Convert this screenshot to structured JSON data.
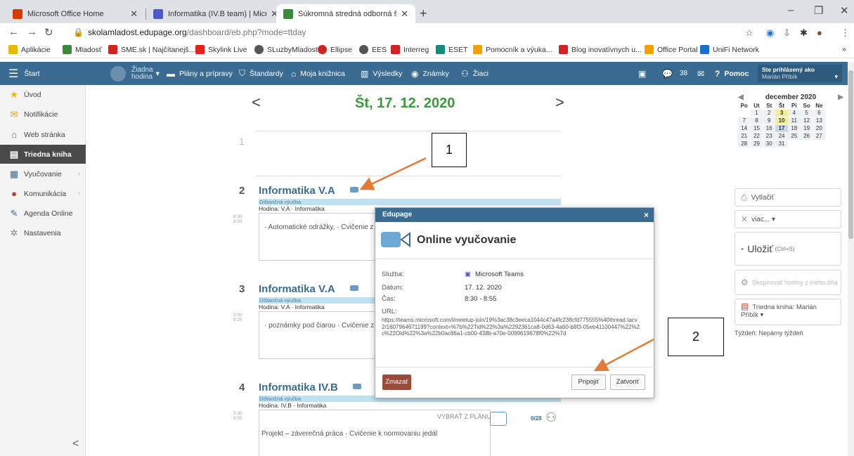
{
  "browser": {
    "tabs": [
      {
        "title": "Microsoft Office Home",
        "color": "#d83b01"
      },
      {
        "title": "Informatika (IV.B team) | Microso",
        "color": "#5059c9"
      },
      {
        "title": "Súkromná stredná odborná škola",
        "color": "#3a8a3a"
      }
    ],
    "new_tab": "+",
    "url_host": "skolamladost.edupage.org",
    "url_path": "/dashboard/eb.php?mode=ttday",
    "bookmarks": [
      {
        "label": "Aplikácie",
        "color": "#e6b800"
      },
      {
        "label": "Mladosť",
        "color": "#3a8a3a"
      },
      {
        "label": "SME.sk | Najčítanejš...",
        "color": "#d02424"
      },
      {
        "label": "Skylink Live",
        "color": "#e2231a"
      },
      {
        "label": "SLuzbyMladost",
        "color": "#555555"
      },
      {
        "label": "Ellipse",
        "color": "#d02424"
      },
      {
        "label": "EES",
        "color": "#555555"
      },
      {
        "label": "Interreg",
        "color": "#d02424"
      },
      {
        "label": "ESET",
        "color": "#1a8a7a"
      },
      {
        "label": "Pomocník a výuka...",
        "color": "#f2a100"
      },
      {
        "label": "Blog inovatívnych u...",
        "color": "#d02424"
      },
      {
        "label": "Office Portal",
        "color": "#f2a100"
      },
      {
        "label": "UniFi Network",
        "color": "#1a6fc9"
      }
    ],
    "bookmarks_more": "»"
  },
  "header": {
    "start": "Štart",
    "hodina_line1": "Žiadna",
    "hodina_line2": "hodina",
    "menu": [
      "Plány a prípravy",
      "Štandardy",
      "Moja knižnica",
      "Výsledky",
      "Známky",
      "Žiaci"
    ],
    "messages_count": "38",
    "help": "Pomoc",
    "logged_as_label": "Ste prihlásený ako",
    "logged_user": "Marián Příbík"
  },
  "sidebar": {
    "items": [
      {
        "label": "Úvod",
        "icon": "star-icon"
      },
      {
        "label": "Notifikácie",
        "icon": "mail-icon"
      },
      {
        "label": "Web stránka",
        "icon": "home-icon"
      },
      {
        "label": "Triedna kniha",
        "icon": "book-icon"
      },
      {
        "label": "Vyučovanie",
        "icon": "teach-icon"
      },
      {
        "label": "Komunikácia",
        "icon": "chat-icon"
      },
      {
        "label": "Agenda Online",
        "icon": "pen-icon"
      },
      {
        "label": "Nastavenia",
        "icon": "gear-icon"
      }
    ],
    "active": "Triedna kniha",
    "collapse": "<"
  },
  "day": {
    "prev": "<",
    "title": "Št, 17. 12. 2020",
    "next": ">",
    "empty_lesson": "1"
  },
  "lessons": [
    {
      "num": "2",
      "title": "Informatika V.A",
      "dist": "Dištančná výučba",
      "hodina": "Hodina: V.A · Informatika",
      "time_from": "8:30",
      "time_to": "8:55",
      "text": "· Automatické odrážky, · Cvičenie z r"
    },
    {
      "num": "3",
      "title": "Informatika V.A",
      "dist": "Dištančná výučba",
      "hodina": "Hodina: V.A · Informatika",
      "time_from": "9:00",
      "time_to": "9:25",
      "text": "· poznámky pod čiarou · Cvičenie z"
    },
    {
      "num": "4",
      "title": "Informatika IV.B",
      "dist": "Dištančná výučba",
      "hodina": "Hodina: IV.B · Informatika",
      "time_from": "9:30",
      "time_to": "9:55",
      "text": "Projekt – záverečná práca · Cvičenie k normovaniu jedál"
    }
  ],
  "lesson4_extra": {
    "vybrat": "VYBRAŤ Z PLÁNU",
    "count": "0/28"
  },
  "calendar": {
    "month": "december 2020",
    "days": [
      "Po",
      "Ut",
      "St",
      "Št",
      "Pi",
      "So",
      "Ne"
    ],
    "weeks": [
      [
        "",
        "1",
        "2",
        "3",
        "4",
        "5",
        "6"
      ],
      [
        "7",
        "8",
        "9",
        "10",
        "11",
        "12",
        "13"
      ],
      [
        "14",
        "15",
        "16",
        "17",
        "18",
        "19",
        "20"
      ],
      [
        "21",
        "22",
        "23",
        "24",
        "25",
        "26",
        "27"
      ],
      [
        "28",
        "29",
        "30",
        "31",
        "",
        "",
        ""
      ]
    ],
    "highlighted": [
      "3",
      "10"
    ],
    "today": "17"
  },
  "right_panel": {
    "print": "Vytlačiť",
    "more": "viac... ▾",
    "save": "Uložiť",
    "save_hint": "(Ctrl+S)",
    "copy": "Skopírovať hodiny z iného dňa",
    "classbook_line1": "Triedna kniha: Marián",
    "classbook_line2": "Příbík ▾",
    "week": "Týždeň: Nepárny týždeň"
  },
  "modal": {
    "header": "Edupage",
    "close": "×",
    "title": "Online vyučovanie",
    "service_label": "Služba:",
    "service_value": "Microsoft Teams",
    "date_label": "Dátum:",
    "date_value": "17. 12. 2020",
    "time_label": "Čas:",
    "time_value": "8:30 - 8:55",
    "url_label": "URL:",
    "url_value": "https://teams.microsoft.com/l/meetup-join/19%3ac38c3eeca1044c47a4fc238cfd775555%40thread.tacv2/1607964671199?context=%7b%22Tid%22%3a%2292361ca8-0d63-4a60-b8f3-05eb41100447%22%2c%22Oid%22%3a%22b0ac86a1-cb00-438b-a70e-0099619678f0%22%7d",
    "delete": "Zmazať",
    "join": "Pripojiť",
    "close_btn": "Zatvoriť"
  },
  "callouts": {
    "one": "1",
    "two": "2"
  },
  "colors": {
    "accent": "#3a6c93",
    "date_green": "#3a9a3a",
    "arrow": "#e07b39"
  }
}
